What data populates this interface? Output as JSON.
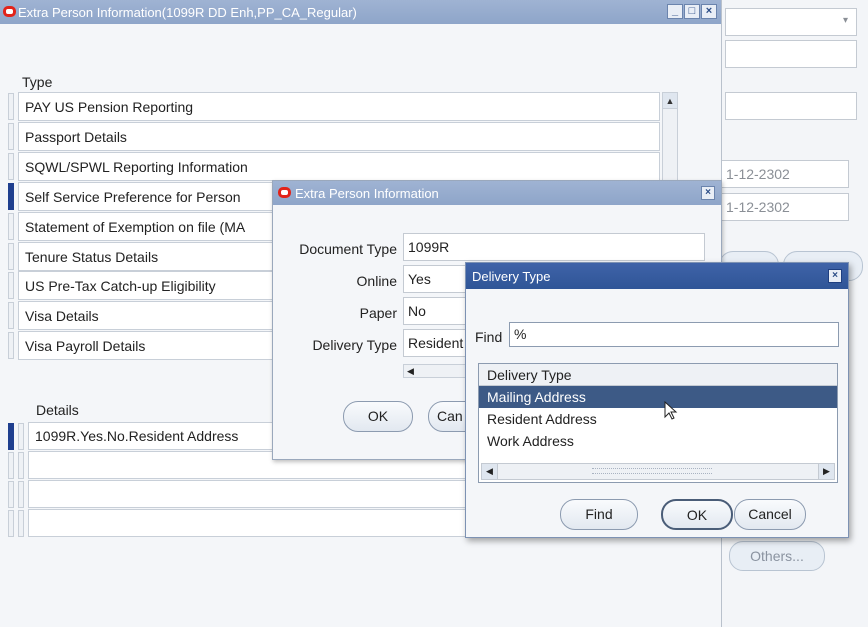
{
  "main_window": {
    "title": "Extra Person Information(1099R DD Enh,PP_CA_Regular)",
    "controls": [
      "_",
      "□",
      "×"
    ],
    "type_label": "Type",
    "types": [
      "PAY US Pension Reporting",
      "Passport Details",
      "SQWL/SPWL Reporting Information",
      "Self Service Preference for Person",
      "Statement of Exemption on file (MA",
      "Tenure Status Details",
      "US Pre-Tax Catch-up Eligibility",
      "Visa Details",
      "Visa Payroll Details"
    ],
    "details_label": "Details",
    "details": [
      "1099R.Yes.No.Resident Address",
      "",
      "",
      ""
    ]
  },
  "background_form": {
    "field_1": "1-12-2302",
    "field_2": "1-12-2302",
    "others_button": "Others..."
  },
  "epi_dialog": {
    "title": "Extra Person Information",
    "fields": [
      {
        "label": "Document Type",
        "value": "1099R"
      },
      {
        "label": "Online",
        "value": "Yes"
      },
      {
        "label": "Paper",
        "value": "No"
      },
      {
        "label": "Delivery Type",
        "value": "Resident"
      }
    ],
    "ok_button": "OK",
    "cancel_button": "Can"
  },
  "lov_dialog": {
    "title": "Delivery Type",
    "find_label": "Find",
    "find_value": "%",
    "column_header": "Delivery Type",
    "items": [
      "Mailing Address",
      "Resident Address",
      "Work Address"
    ],
    "selected_item": "Mailing Address",
    "find_button": "Find",
    "ok_button": "OK",
    "cancel_button": "Cancel"
  },
  "colors": {
    "titlebar_inactive": "#9fb3d3",
    "titlebar_active": "#3f63a8",
    "selection": "#3d5a86",
    "oracle_red": "#e2231a"
  }
}
